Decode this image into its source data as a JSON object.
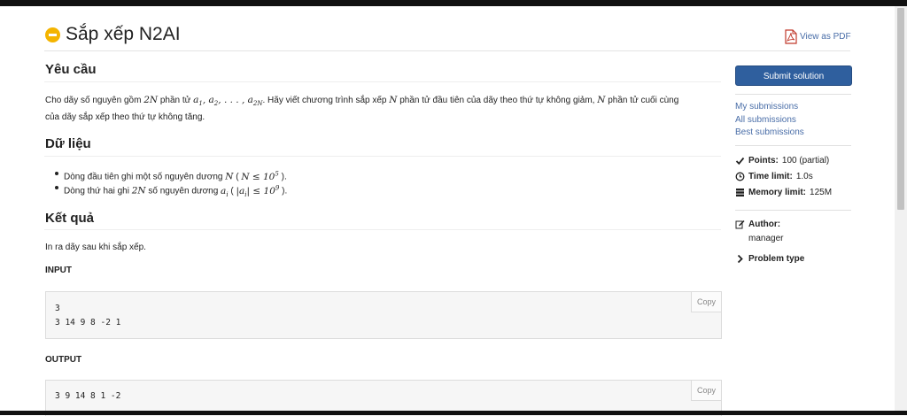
{
  "problem": {
    "title": "Sắp xếp N2AI",
    "view_pdf": "View as PDF"
  },
  "statement": {
    "requirement_heading": "Yêu cầu",
    "requirement_part1": "Cho dãy số nguyên gồm ",
    "requirement_part2": " phần tử ",
    "requirement_part3": ". Hãy viết chương trình sắp xếp ",
    "requirement_part4": " phần tử đầu tiên của dãy theo thứ tự không giảm, ",
    "requirement_part5": " phần tử cuối cùng",
    "requirement_line2": "của dãy sắp xếp theo thứ tự không tăng.",
    "input_heading": "Dữ liệu",
    "input_item1_text": "Dòng đầu tiên ghi một số nguyên dương ",
    "input_item2_text_a": "Dòng thứ hai ghi ",
    "input_item2_text_b": " số nguyên dương ",
    "output_heading": "Kết quả",
    "output_text": "In ra dãy sau khi sắp xếp."
  },
  "samples": {
    "input_label": "INPUT",
    "input_lines": [
      "3",
      "3 14 9 8 -2 1"
    ],
    "output_label": "OUTPUT",
    "output_lines": [
      "3 9 14 8 1 -2"
    ],
    "copy_label": "Copy"
  },
  "sidebar": {
    "submit_label": "Submit solution",
    "links": [
      "My submissions",
      "All submissions",
      "Best submissions"
    ],
    "points_label": "Points:",
    "points_value": "100 (partial)",
    "time_label": "Time limit:",
    "time_value": "1.0s",
    "memory_label": "Memory limit:",
    "memory_value": "125M",
    "author_label": "Author:",
    "author_value": "manager",
    "problem_type_label": "Problem type"
  },
  "colors": {
    "accent": "#2f5f9e",
    "link": "#4a6ea8",
    "status": "#f4b400"
  }
}
